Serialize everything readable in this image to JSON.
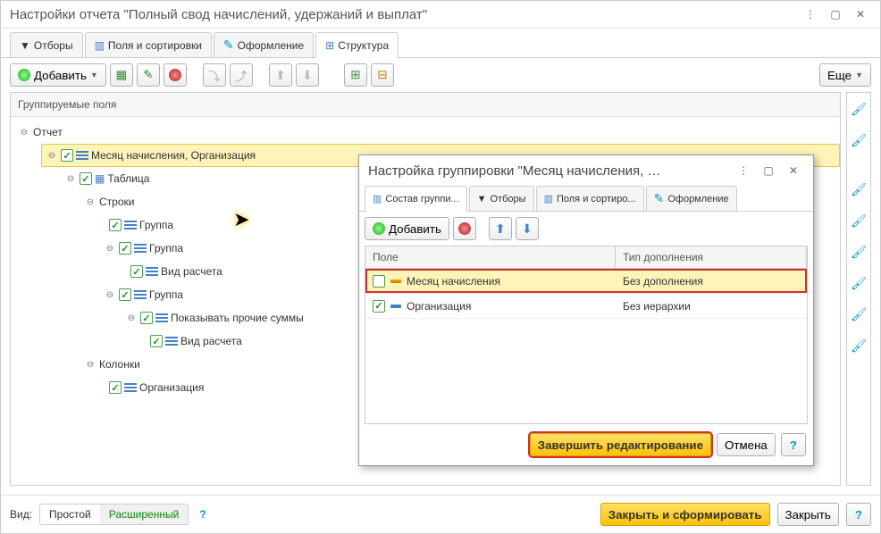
{
  "window": {
    "title": "Настройки отчета \"Полный свод начислений, удержаний и выплат\""
  },
  "mainTabs": {
    "filters": "Отборы",
    "fields": "Поля и сортировки",
    "design": "Оформление",
    "structure": "Структура"
  },
  "toolbar": {
    "add": "Добавить",
    "more": "Еще"
  },
  "treePanel": {
    "header": "Группируемые поля",
    "nodes": {
      "root": "Отчет",
      "month_org": "Месяц начисления, Организация",
      "table": "Таблица",
      "rows": "Строки",
      "group1": "Группа",
      "group2": "Группа",
      "calc_type1": "Вид расчета",
      "group3": "Группа",
      "other_sums": "Показывать прочие суммы",
      "calc_type2": "Вид расчета",
      "columns": "Колонки",
      "org": "Организация"
    }
  },
  "popup": {
    "title": "Настройка группировки \"Месяц начисления, …",
    "tabs": {
      "composition": "Состав группи...",
      "filters": "Отборы",
      "fields": "Поля и сортиро...",
      "design": "Оформление"
    },
    "toolbar": {
      "add": "Добавить"
    },
    "grid": {
      "col_field": "Поле",
      "col_type": "Тип дополнения",
      "rows": [
        {
          "checked": false,
          "field": "Месяц начисления",
          "type": "Без дополнения"
        },
        {
          "checked": true,
          "field": "Организация",
          "type": "Без иерархии"
        }
      ]
    },
    "footer": {
      "finish": "Завершить редактирование",
      "cancel": "Отмена"
    }
  },
  "bottom": {
    "view_label": "Вид:",
    "simple": "Простой",
    "advanced": "Расширенный",
    "close_generate": "Закрыть и сформировать",
    "close": "Закрыть"
  }
}
